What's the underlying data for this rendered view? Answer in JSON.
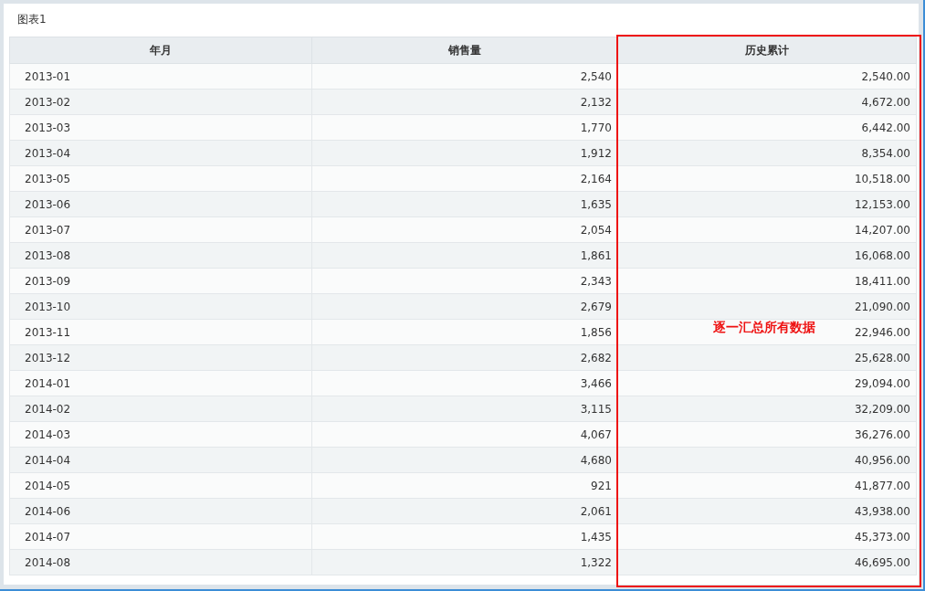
{
  "panel": {
    "title": "图表1"
  },
  "table": {
    "columns": [
      "年月",
      "销售量",
      "历史累计"
    ],
    "rows": [
      [
        "2013-01",
        "2,540",
        "2,540.00"
      ],
      [
        "2013-02",
        "2,132",
        "4,672.00"
      ],
      [
        "2013-03",
        "1,770",
        "6,442.00"
      ],
      [
        "2013-04",
        "1,912",
        "8,354.00"
      ],
      [
        "2013-05",
        "2,164",
        "10,518.00"
      ],
      [
        "2013-06",
        "1,635",
        "12,153.00"
      ],
      [
        "2013-07",
        "2,054",
        "14,207.00"
      ],
      [
        "2013-08",
        "1,861",
        "16,068.00"
      ],
      [
        "2013-09",
        "2,343",
        "18,411.00"
      ],
      [
        "2013-10",
        "2,679",
        "21,090.00"
      ],
      [
        "2013-11",
        "1,856",
        "22,946.00"
      ],
      [
        "2013-12",
        "2,682",
        "25,628.00"
      ],
      [
        "2014-01",
        "3,466",
        "29,094.00"
      ],
      [
        "2014-02",
        "3,115",
        "32,209.00"
      ],
      [
        "2014-03",
        "4,067",
        "36,276.00"
      ],
      [
        "2014-04",
        "4,680",
        "40,956.00"
      ],
      [
        "2014-05",
        "921",
        "41,877.00"
      ],
      [
        "2014-06",
        "2,061",
        "43,938.00"
      ],
      [
        "2014-07",
        "1,435",
        "45,373.00"
      ],
      [
        "2014-08",
        "1,322",
        "46,695.00"
      ]
    ]
  },
  "annotation": {
    "text": "逐一汇总所有数据"
  }
}
